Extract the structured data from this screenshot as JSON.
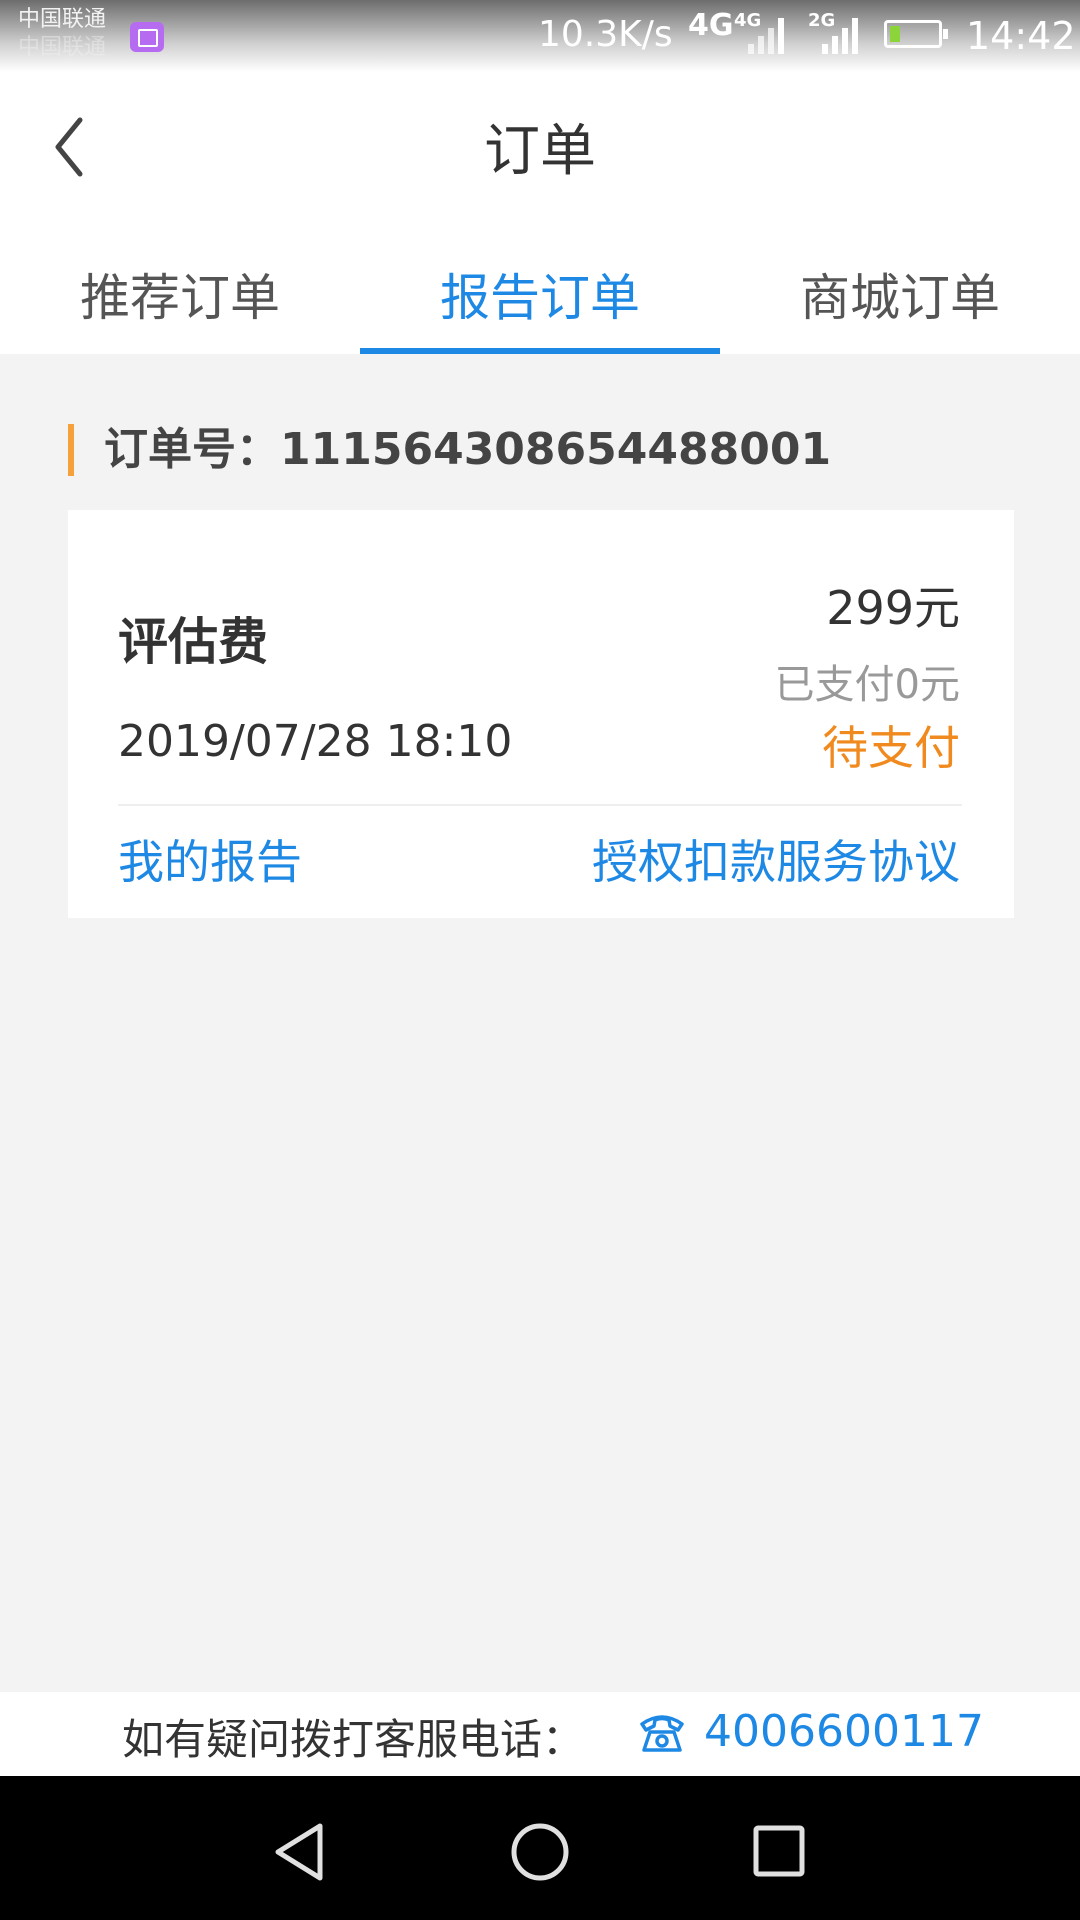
{
  "status_bar": {
    "carrier_1": "中国联通",
    "carrier_2": "中国联通",
    "net_speed": "10.3K/s",
    "network_1": "4G",
    "network_1_small": "4G",
    "network_2_small": "2G",
    "time": "14:42"
  },
  "header": {
    "title": "订单",
    "back_icon": "chevron-left-icon"
  },
  "tabs": [
    {
      "label": "推荐订单",
      "active": false
    },
    {
      "label": "报告订单",
      "active": true
    },
    {
      "label": "商城订单",
      "active": false
    }
  ],
  "order": {
    "number_label": "订单号：111564308654488001",
    "fee_title": "评估费",
    "amount": "299元",
    "paid": "已支付0元",
    "status": "待支付",
    "datetime": "2019/07/28 18:10",
    "link_report": "我的报告",
    "link_agreement": "授权扣款服务协议"
  },
  "footer": {
    "text": "如有疑问拨打客服电话：",
    "phone": "4006600117",
    "phone_icon": "telephone-icon"
  },
  "nav": {
    "back_icon": "triangle-back-icon",
    "home_icon": "circle-home-icon",
    "recents_icon": "square-recents-icon"
  },
  "colors": {
    "accent": "#1e88e5",
    "status_pending": "#f08a1e",
    "order_marker": "#f5a03a"
  }
}
